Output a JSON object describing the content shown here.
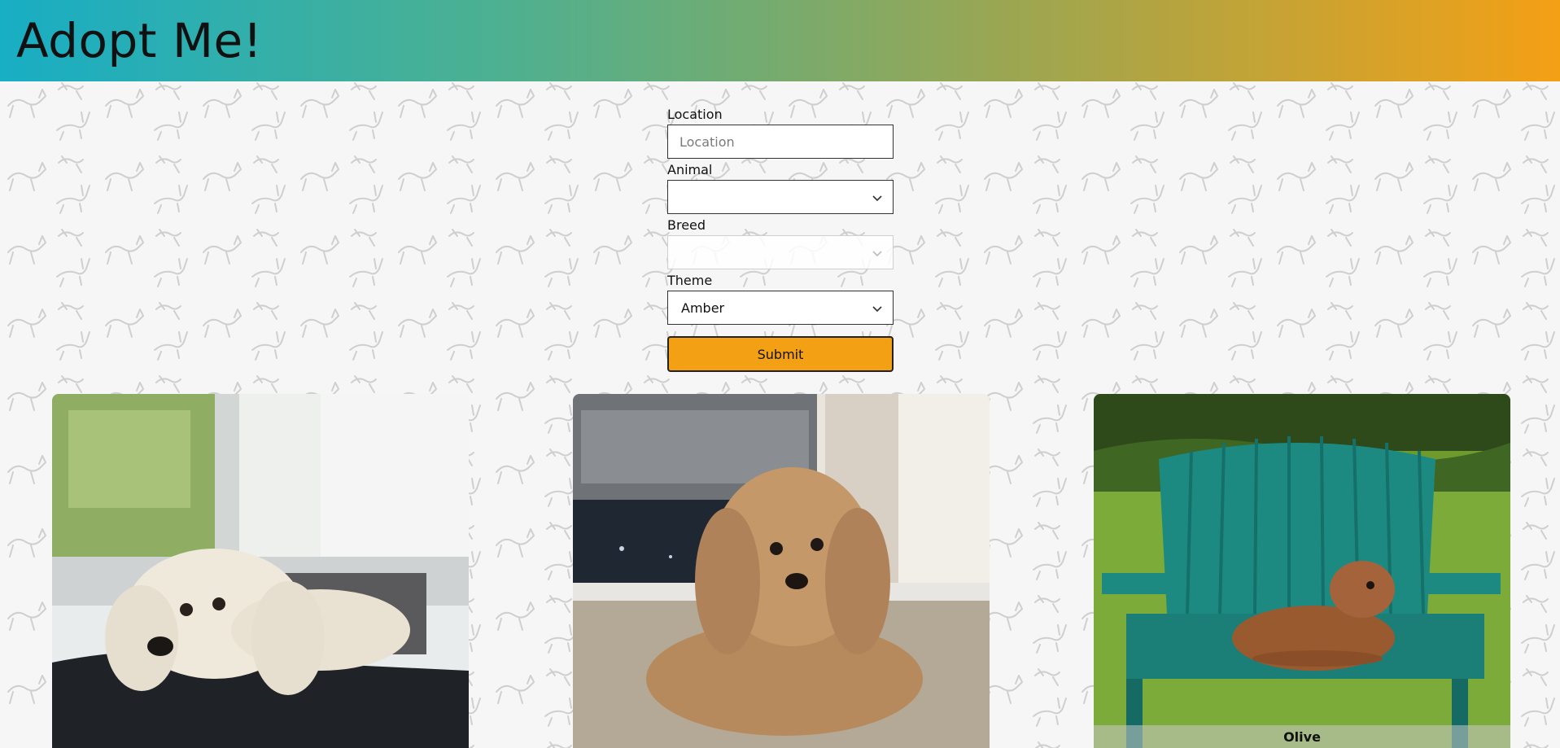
{
  "header": {
    "brand": "Adopt Me!"
  },
  "search_form": {
    "location": {
      "label": "Location",
      "placeholder": "Location",
      "value": ""
    },
    "animal": {
      "label": "Animal",
      "value": ""
    },
    "breed": {
      "label": "Breed",
      "value": "",
      "disabled": true
    },
    "theme": {
      "label": "Theme",
      "value": "Amber"
    },
    "submit_label": "Submit"
  },
  "pets": [
    {
      "name": "",
      "image": "white fluffy dog lying in a suitcase"
    },
    {
      "name": "",
      "image": "tan curly-haired dog lying on carpet"
    },
    {
      "name": "Olive",
      "image": "brown dog lying on a teal adirondack bench"
    }
  ],
  "colors": {
    "header_gradient": [
      "#18aec4",
      "#4fb08f",
      "#9ea64f",
      "#f4a015"
    ],
    "accent": "#f4a015",
    "page_background": "#f6f6f6"
  },
  "icons": {
    "select_chevron": "chevron-down-icon"
  }
}
